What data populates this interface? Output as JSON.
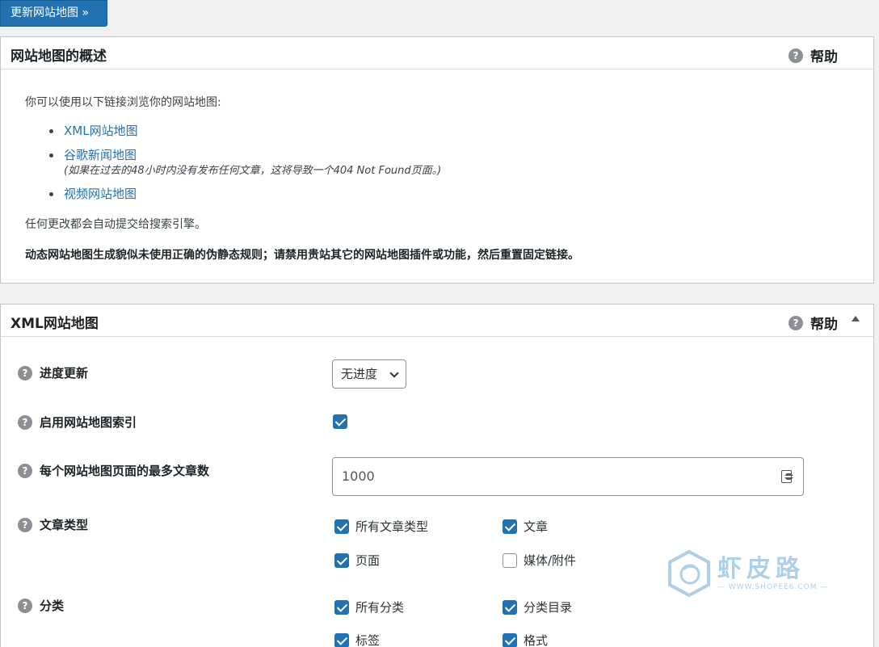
{
  "top_button": {
    "label": "更新网站地图 »"
  },
  "overview": {
    "title": "网站地图的概述",
    "help": "帮助",
    "intro": "你可以使用以下链接浏览你的网站地图:",
    "links": [
      {
        "label": "XML网站地图",
        "note": ""
      },
      {
        "label": "谷歌新闻地图",
        "note": "(如果在过去的48小时内没有发布任何文章，这将导致一个404 Not Found页面。)"
      },
      {
        "label": "视频网站地图",
        "note": ""
      }
    ],
    "auto_submit": "任何更改都会自动提交给搜索引擎。",
    "warning": "动态网站地图生成貌似未使用正确的伪静态规则；请禁用贵站其它的网站地图插件或功能，然后重置固定链接。"
  },
  "xml_sitemap": {
    "title": "XML网站地图",
    "help": "帮助",
    "progress": {
      "label": "进度更新",
      "value": "无进度"
    },
    "index": {
      "label": "启用网站地图索引",
      "checked": true
    },
    "max_posts": {
      "label": "每个网站地图页面的最多文章数",
      "value": "1000"
    },
    "post_types": {
      "label": "文章类型",
      "options": [
        {
          "label": "所有文章类型",
          "checked": true
        },
        {
          "label": "文章",
          "checked": true
        },
        {
          "label": "页面",
          "checked": true
        },
        {
          "label": "媒体/附件",
          "checked": false
        }
      ]
    },
    "taxonomies": {
      "label": "分类",
      "options": [
        {
          "label": "所有分类",
          "checked": true
        },
        {
          "label": "分类目录",
          "checked": true
        },
        {
          "label": "标签",
          "checked": true
        },
        {
          "label": "格式",
          "checked": true
        }
      ]
    }
  },
  "watermark": {
    "brand": "虾皮路",
    "url": "— WWW.SHOPEE6.COM —"
  },
  "colors": {
    "accent": "#2271b1",
    "panel_border": "#c3c4c7",
    "background": "#f0f0f1"
  }
}
